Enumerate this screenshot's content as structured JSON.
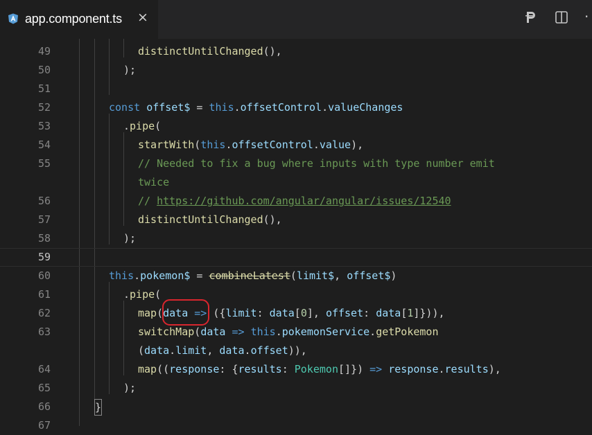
{
  "tab": {
    "filename": "app.component.ts",
    "close_glyph": "×",
    "file_icon": "angular-icon"
  },
  "actions": {
    "preview_icon": "preview-icon",
    "split_icon": "split-editor-icon",
    "more_glyph": "·"
  },
  "editor": {
    "current_line": 59,
    "highlighted_token": "data",
    "lines": [
      {
        "n": "49",
        "t": "distinctUntilChanged(),"
      },
      {
        "n": "50",
        "t": ");"
      },
      {
        "n": "51",
        "t": ""
      },
      {
        "n": "52",
        "t": "const offset$ = this.offsetControl.valueChanges"
      },
      {
        "n": "53",
        "t": ".pipe("
      },
      {
        "n": "54",
        "t": "startWith(this.offsetControl.value),"
      },
      {
        "n": "55",
        "t": "// Needed to fix a bug where inputs with type number emit"
      },
      {
        "n": "",
        "t": "twice"
      },
      {
        "n": "56",
        "t": "// https://github.com/angular/angular/issues/12540"
      },
      {
        "n": "57",
        "t": "distinctUntilChanged(),"
      },
      {
        "n": "58",
        "t": ");"
      },
      {
        "n": "59",
        "t": ""
      },
      {
        "n": "60",
        "t": "this.pokemon$ = combineLatest(limit$, offset$)"
      },
      {
        "n": "61",
        "t": ".pipe("
      },
      {
        "n": "62",
        "t": "map(data => ({limit: data[0], offset: data[1]})),"
      },
      {
        "n": "63",
        "t": "switchMap(data => this.pokemonService.getPokemon"
      },
      {
        "n": "",
        "t": "(data.limit, data.offset)),"
      },
      {
        "n": "64",
        "t": "map((response: {results: Pokemon[]}) => response.results),"
      },
      {
        "n": "65",
        "t": ");"
      },
      {
        "n": "66",
        "t": "}"
      },
      {
        "n": "67",
        "t": ""
      }
    ]
  }
}
